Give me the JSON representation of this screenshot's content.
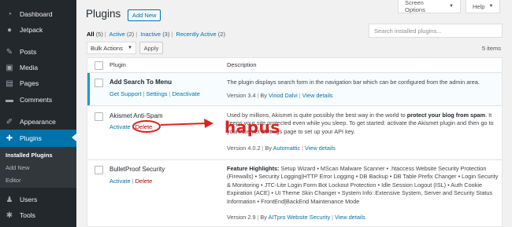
{
  "sidebar": {
    "items": [
      {
        "label": "Dashboard",
        "icon": "dashboard-icon",
        "glyph": "◔"
      },
      {
        "label": "Jetpack",
        "icon": "jetpack-icon",
        "glyph": "●"
      },
      {
        "label": "Posts",
        "icon": "pin-icon",
        "glyph": "✎"
      },
      {
        "label": "Media",
        "icon": "media-icon",
        "glyph": "▣"
      },
      {
        "label": "Pages",
        "icon": "pages-icon",
        "glyph": "▤"
      },
      {
        "label": "Comments",
        "icon": "comment-icon",
        "glyph": "▬"
      },
      {
        "label": "Appearance",
        "icon": "brush-icon",
        "glyph": "✐"
      },
      {
        "label": "Plugins",
        "icon": "plugin-icon",
        "glyph": "✚"
      },
      {
        "label": "Users",
        "icon": "users-icon",
        "glyph": "♟"
      },
      {
        "label": "Tools",
        "icon": "wrench-icon",
        "glyph": "✱"
      }
    ],
    "submenu": [
      "Installed Plugins",
      "Add New",
      "Editor"
    ]
  },
  "topbar": {
    "screen_options": "Screen Options",
    "help": "Help"
  },
  "header": {
    "title": "Plugins",
    "add_new": "Add New"
  },
  "filters": {
    "all": "All",
    "all_count": "(5)",
    "active": "Active",
    "active_count": "(2)",
    "inactive": "Inactive",
    "inactive_count": "(3)",
    "recent": "Recently Active",
    "recent_count": "(2)"
  },
  "search": {
    "placeholder": "Search installed plugins..."
  },
  "bulk": {
    "label": "Bulk Actions",
    "apply": "Apply",
    "items_count": "5 items"
  },
  "table": {
    "col_plugin": "Plugin",
    "col_description": "Description"
  },
  "plugins": [
    {
      "name": "Add Search To Menu",
      "action1": "Get Support",
      "action2": "Settings",
      "action3": "Deactivate",
      "desc": "The plugin displays search form in the navigation bar which can be configured from the admin area.",
      "version": "Version 3.4",
      "by": "By",
      "author": "Vinod Dalvi",
      "details": "View details"
    },
    {
      "name": "Akismet Anti-Spam",
      "action1": "Activate",
      "action2": "Delete",
      "desc_1": "Used by millions, Akismet is quite possibly the best way in the world to ",
      "desc_bold": "protect your blog from spam",
      "desc_2": ". It keeps your site protected even while you sleep. To get started: activate the Akismet plugin and then go to your Akismet Settings page to set up your API key.",
      "version": "Version 4.0.2",
      "by": "By",
      "author": "Automattic",
      "details": "View details"
    },
    {
      "name": "BulletProof Security",
      "action1": "Activate",
      "action2": "Delete",
      "desc_bold": "Feature Highlights:",
      "desc_2": " Setup Wizard • MScan Malware Scanner • .htaccess Website Security Protection (Firewalls) • Security Logging|HTTP Error Logging • DB Backup • DB Table Prefix Changer • Login Security & Monitoring • JTC-Lite Login Form Bot Lockout Protection • Idle Session Logout (ISL) • Auth Cookie Expiration (ACE) • UI Theme Skin Changer • System Info: Extensive System, Server and Security Status Information • FrontEnd|BackEnd Maintenance Mode",
      "version": "Version 2.9",
      "by": "By",
      "author": "AITpro Website Security",
      "details": "View details"
    }
  ],
  "annotation": {
    "text": "hapus",
    "color": "#e02020"
  },
  "colors": {
    "accent": "#0073aa",
    "sidebar": "#23282d",
    "delete": "#aa0000",
    "active_border": "#00a0d2"
  }
}
